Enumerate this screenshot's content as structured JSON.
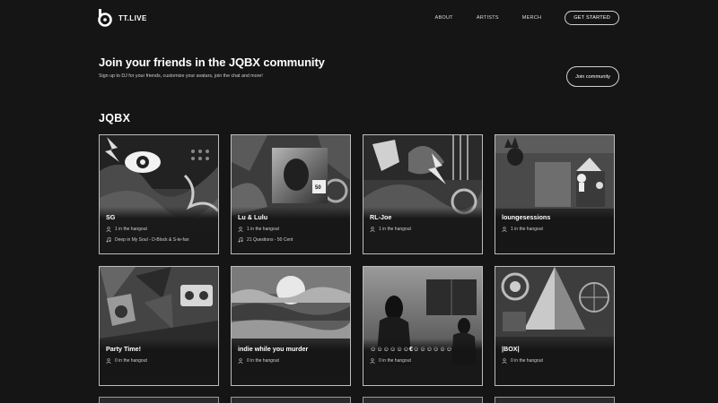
{
  "header": {
    "brand": "TT.LIVE",
    "logo_icon": "tt-live-logo-icon",
    "links": [
      "ABOUT",
      "ARTISTS",
      "MERCH"
    ],
    "cta": "GET STARTED"
  },
  "banner": {
    "title": "Join your friends in the JQBX community",
    "subtitle": "Sign up to DJ for your friends, customize your avatars, join the chat and more!",
    "button": "Join community"
  },
  "section": {
    "title": "JQBX"
  },
  "icons": {
    "people": "person-icon",
    "music": "music-note-icon"
  },
  "cards": [
    {
      "title": "SG",
      "listeners": "1 in the hangout",
      "now_playing": "Deep in My Soul - D-Block & S-te-fan"
    },
    {
      "title": "Lu & Lulu",
      "listeners": "1 in the hangout",
      "now_playing": "21 Questions - 50 Cent"
    },
    {
      "title": "RL-Joe",
      "listeners": "1 in the hangout"
    },
    {
      "title": "loungesessions",
      "listeners": "1 in the hangout"
    },
    {
      "title": "Party Time!",
      "listeners": "0 in the hangout"
    },
    {
      "title": "indie while you murder",
      "listeners": "0 in the hangout"
    },
    {
      "title": "☺☺☺☺☺☺€☺☺☺☺☺☺",
      "listeners": "0 in the hangout"
    },
    {
      "title": "|BOX|",
      "listeners": "0 in the hangout"
    }
  ]
}
